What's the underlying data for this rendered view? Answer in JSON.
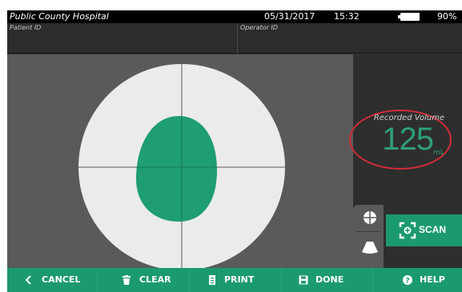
{
  "status_bar": {
    "hospital": "Public County Hospital",
    "date": "05/31/2017",
    "time": "15:32",
    "battery_percent": "90%",
    "battery_level": 0.9
  },
  "id_bar": {
    "patient_label": "Patient ID",
    "operator_label": "Operator ID"
  },
  "volume": {
    "label": "Recorded Volume",
    "value": "125",
    "unit": "mL"
  },
  "scan_button": {
    "label": "SCAN",
    "icon": "scan-target-icon"
  },
  "view_tabs": [
    {
      "icon": "crosshair-icon"
    },
    {
      "icon": "ultrasound-cone-icon"
    }
  ],
  "bottom_bar": {
    "cancel": "CANCEL",
    "clear": "CLEAR",
    "print": "PRINT",
    "done": "DONE",
    "help": "HELP"
  },
  "colors": {
    "accent": "#1c9a6f",
    "bladder": "#1e9e72",
    "highlight_oval": "#d22c3a",
    "volume_text": "#2e9f77"
  }
}
